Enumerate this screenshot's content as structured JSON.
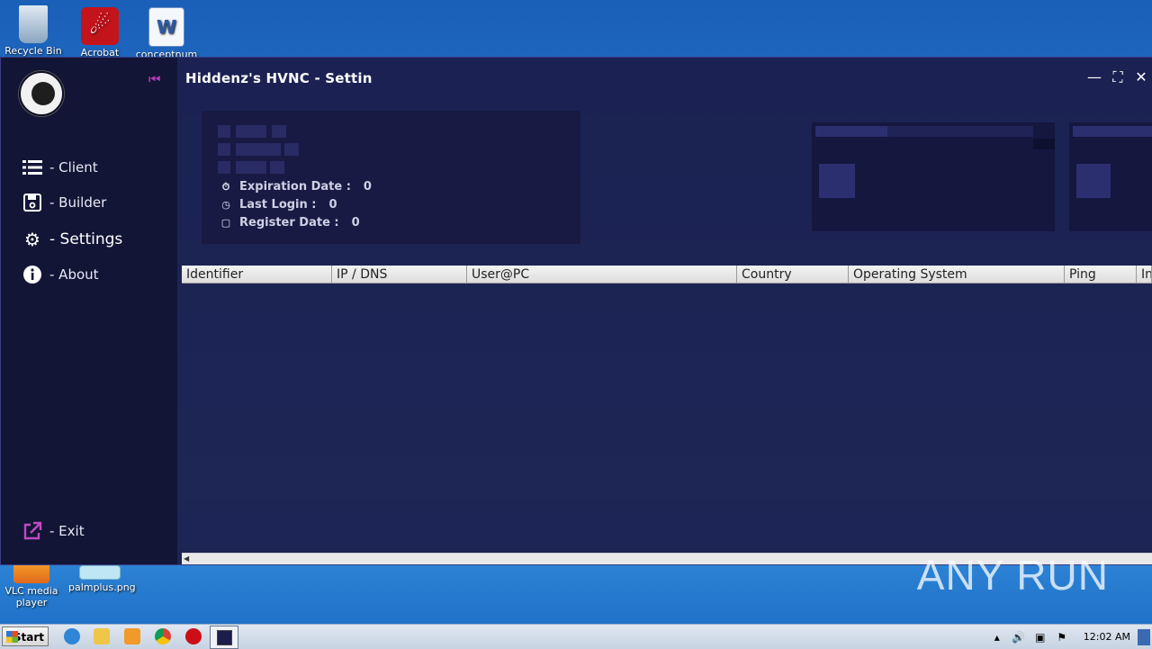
{
  "desktop": {
    "icons": [
      {
        "label": "Recycle Bin",
        "icon": "recycle-bin-icon"
      },
      {
        "label": "Acrobat",
        "icon": "acrobat-icon"
      },
      {
        "label": "conceptnum",
        "icon": "word-doc-icon"
      },
      {
        "label": "VLC media player",
        "icon": "vlc-icon"
      },
      {
        "label": "palmplus.png",
        "icon": "image-file-icon"
      }
    ]
  },
  "window": {
    "title": "Hiddenz's HVNC - Settin",
    "controls": {
      "minimize": "—",
      "maximize": "⛶",
      "close": "✕"
    }
  },
  "sidebar": {
    "items": [
      {
        "label": "- Client",
        "icon": "list-icon"
      },
      {
        "label": "- Builder",
        "icon": "save-icon"
      },
      {
        "label": "- Settings",
        "icon": "gears-icon",
        "active": true
      },
      {
        "label": "- About",
        "icon": "info-icon"
      }
    ],
    "exit": {
      "label": "- Exit",
      "icon": "external-link-icon"
    }
  },
  "license": {
    "expiration_label": "Expiration Date :",
    "expiration_value": "0",
    "last_login_label": "Last Login :",
    "last_login_value": "0",
    "register_label": "Register Date :",
    "register_value": "0"
  },
  "table": {
    "columns": [
      "Identifier",
      "IP / DNS",
      "User@PC",
      "Country",
      "Operating System",
      "Ping",
      "In"
    ],
    "rows": []
  },
  "taskbar": {
    "start_label": "Start",
    "clock": "12:02 AM"
  },
  "watermark": "ANY RUN",
  "colors": {
    "accent": "#b43ab8",
    "window_bg": "#1b1d4a",
    "sidebar_bg": "#121434"
  }
}
